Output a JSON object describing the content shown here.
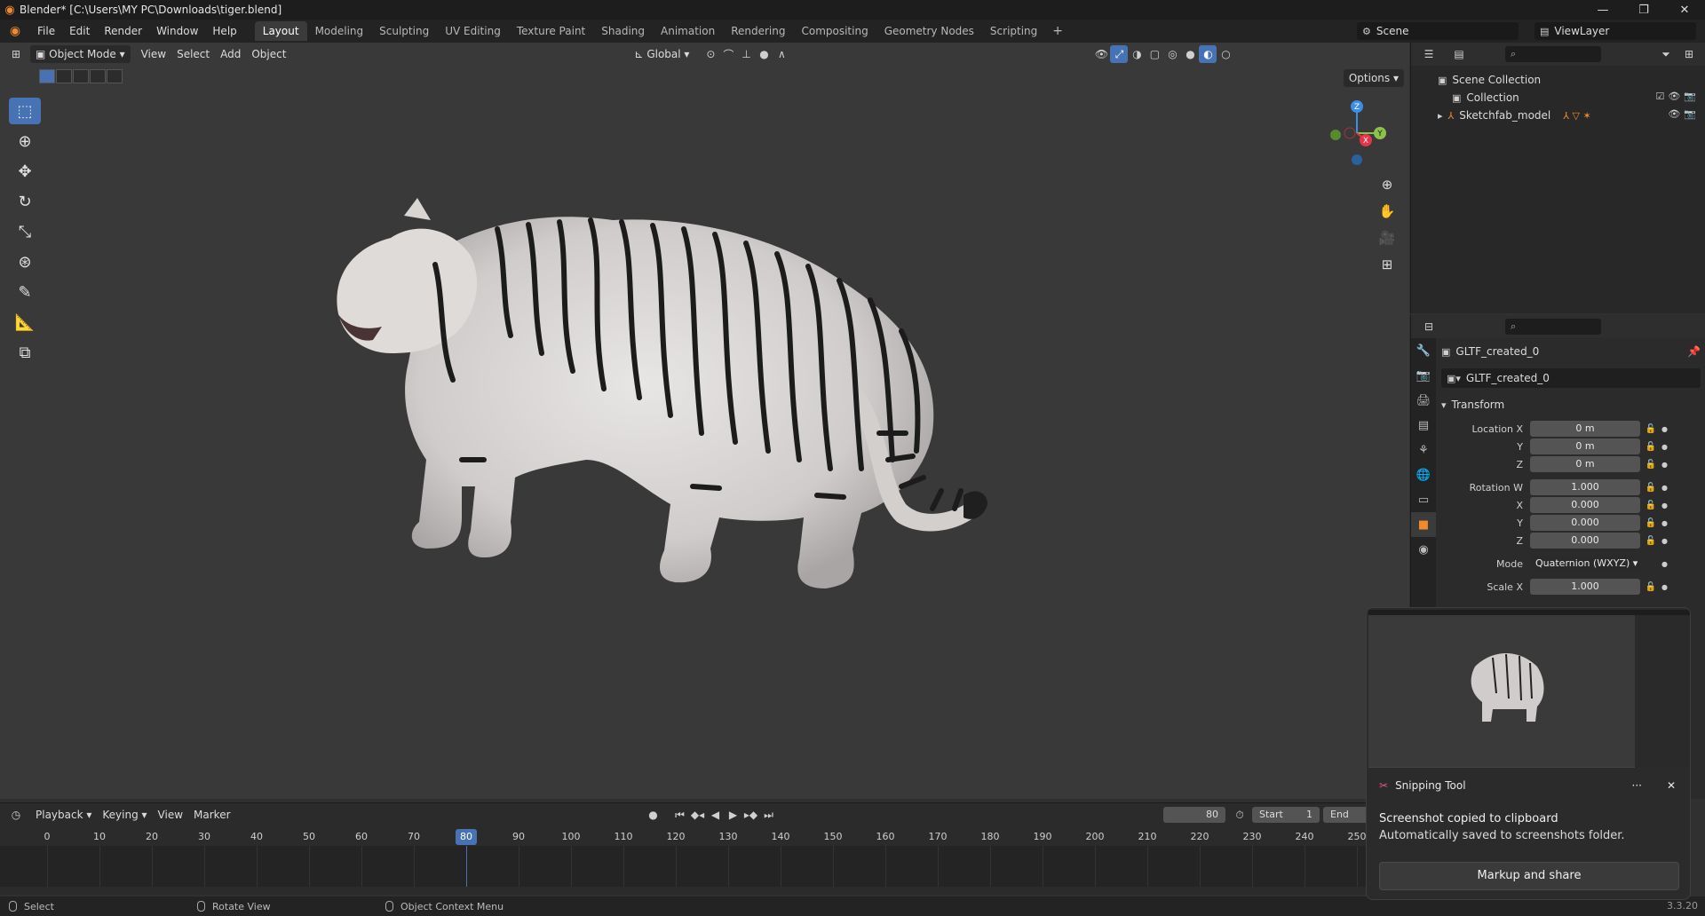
{
  "window": {
    "title": "Blender* [C:\\Users\\MY PC\\Downloads\\tiger.blend]",
    "controls": [
      "—",
      "❐",
      "✕"
    ]
  },
  "menubar": {
    "menus": [
      "File",
      "Edit",
      "Render",
      "Window",
      "Help"
    ],
    "workspace_tabs": [
      "Layout",
      "Modeling",
      "Sculpting",
      "UV Editing",
      "Texture Paint",
      "Shading",
      "Animation",
      "Rendering",
      "Compositing",
      "Geometry Nodes",
      "Scripting"
    ],
    "active_tab": "Layout",
    "add_tab": "+",
    "scene": "Scene",
    "view_layer": "ViewLayer"
  },
  "viewport": {
    "mode": "Object Mode",
    "menus": [
      "View",
      "Select",
      "Add",
      "Object"
    ],
    "transform_orientation": "Global",
    "options_label": "Options",
    "gizmo_axes": {
      "z": "Z",
      "y": "Y",
      "x": "X"
    },
    "colors": {
      "x": "#e8344a",
      "y": "#8bc34a",
      "z": "#3d8ee8",
      "active": "#4772b3"
    }
  },
  "outliner": {
    "items": [
      {
        "label": "Scene Collection"
      },
      {
        "label": "Collection"
      },
      {
        "label": "Sketchfab_model"
      }
    ]
  },
  "properties": {
    "object_name": "GLTF_created_0",
    "data_name": "GLTF_created_0",
    "section": "Transform",
    "fields": [
      {
        "label": "Location X",
        "value": "0 m"
      },
      {
        "label": "Y",
        "value": "0 m"
      },
      {
        "label": "Z",
        "value": "0 m"
      },
      {
        "label": "Rotation W",
        "value": "1.000"
      },
      {
        "label": "X",
        "value": "0.000"
      },
      {
        "label": "Y",
        "value": "0.000"
      },
      {
        "label": "Z",
        "value": "0.000"
      }
    ],
    "mode_label": "Mode",
    "mode_value": "Quaternion (WXYZ)",
    "scale_label": "Scale X",
    "scale_value": "1.000"
  },
  "timeline": {
    "menus": [
      "Playback",
      "Keying",
      "View",
      "Marker"
    ],
    "current_frame": "80",
    "start_label": "Start",
    "start_value": "1",
    "end_label": "End",
    "ticks": [
      "0",
      "10",
      "20",
      "30",
      "40",
      "50",
      "60",
      "70",
      "80",
      "90",
      "100",
      "110",
      "120",
      "130",
      "140",
      "150",
      "160",
      "170",
      "180",
      "190",
      "200",
      "210",
      "220",
      "230",
      "240",
      "250"
    ],
    "playhead": "80"
  },
  "statusbar": {
    "select": "Select",
    "rotate": "Rotate View",
    "context": "Object Context Menu",
    "version": "3.3.20"
  },
  "toast": {
    "app": "Snipping Tool",
    "more": "···",
    "close": "✕",
    "line1": "Screenshot copied to clipboard",
    "line2": "Automatically saved to screenshots folder.",
    "button": "Markup and share"
  }
}
